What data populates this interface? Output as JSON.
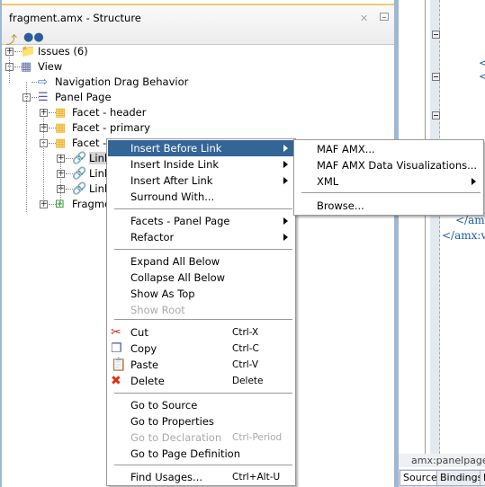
{
  "panel": {
    "title": "fragment.amx - Structure",
    "close_icon": "close-icon",
    "minimize_icon": "minimize-icon",
    "toolbar": [
      "sync-structure-icon",
      "find-binoculars-icon"
    ]
  },
  "tree": [
    {
      "label": "Issues (6)",
      "icon": "folder-warning-icon",
      "expander": "+"
    },
    {
      "label": "View",
      "icon": "view-icon",
      "expander": "-"
    },
    {
      "label": "Navigation Drag Behavior",
      "icon": "navigation-drag-icon",
      "expander": ""
    },
    {
      "label": "Panel Page",
      "icon": "panel-page-icon",
      "expander": "-"
    },
    {
      "label": "Facet - header",
      "icon": "facet-icon",
      "expander": "+"
    },
    {
      "label": "Facet - primary",
      "icon": "facet-icon",
      "expander": "+"
    },
    {
      "label": "Facet -",
      "icon": "facet-icon",
      "expander": "-"
    },
    {
      "label": "Link",
      "icon": "link-icon",
      "expander": "+",
      "selected": true
    },
    {
      "label": "Link",
      "icon": "link-icon",
      "expander": "+"
    },
    {
      "label": "Link",
      "icon": "link-icon",
      "expander": "+"
    },
    {
      "label": "Fragmer",
      "icon": "fragment-icon",
      "expander": "+"
    }
  ],
  "editor": {
    "code_lines": [
      "<",
      "<",
      "</amx",
      "</amx:v"
    ],
    "breadcrumb": "amx:panelpage#",
    "tabs": [
      "Source",
      "Bindings",
      "H"
    ]
  },
  "context_menu": {
    "items": [
      {
        "label": "Insert Before Link",
        "submenu": true,
        "highlighted": true
      },
      {
        "label": "Insert Inside Link",
        "submenu": true
      },
      {
        "label": "Insert After Link",
        "submenu": true
      },
      {
        "label": "Surround With..."
      },
      {
        "label": "Facets - Panel Page",
        "submenu": true
      },
      {
        "label": "Refactor",
        "submenu": true
      },
      {
        "label": "Expand All Below"
      },
      {
        "label": "Collapse All Below"
      },
      {
        "label": "Show As Top"
      },
      {
        "label": "Show Root",
        "disabled": true
      },
      {
        "label": "Cut",
        "shortcut": "Ctrl-X",
        "icon": "scissors-icon"
      },
      {
        "label": "Copy",
        "shortcut": "Ctrl-C",
        "icon": "copy-icon"
      },
      {
        "label": "Paste",
        "shortcut": "Ctrl-V",
        "icon": "paste-icon"
      },
      {
        "label": "Delete",
        "shortcut": "Delete",
        "icon": "delete-x-icon"
      },
      {
        "label": "Go to Source"
      },
      {
        "label": "Go to Properties"
      },
      {
        "label": "Go to Declaration",
        "shortcut": "Ctrl-Period",
        "disabled": true
      },
      {
        "label": "Go to Page Definition"
      },
      {
        "label": "Find Usages...",
        "shortcut": "Ctrl+Alt-U"
      }
    ]
  },
  "submenu": {
    "items": [
      {
        "label": "MAF AMX..."
      },
      {
        "label": "MAF AMX Data Visualizations..."
      },
      {
        "label": "XML",
        "submenu": true
      },
      {
        "label": "Browse..."
      }
    ]
  },
  "colors": {
    "highlight": "#346597",
    "panel_border": "#9db8d2",
    "code": "#1a5ea8"
  }
}
